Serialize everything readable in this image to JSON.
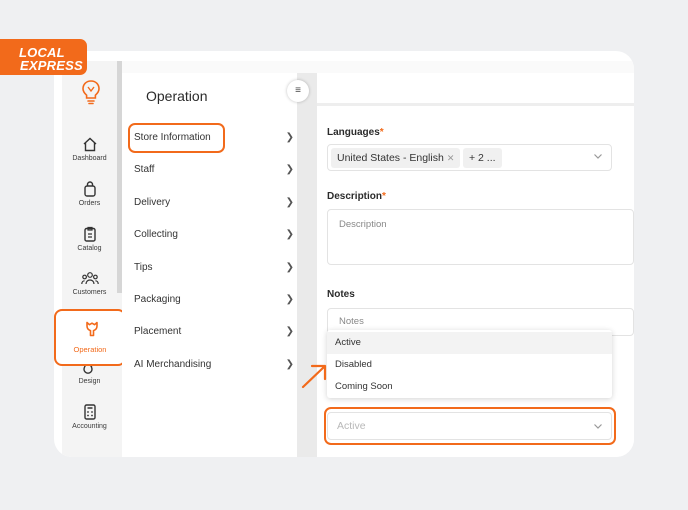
{
  "brand": {
    "logo_line1": "LOCAL",
    "logo_line2": "EXPRESS",
    "accent_color": "#f26a1b"
  },
  "iconbar": {
    "items": [
      {
        "label": "Dashboard",
        "icon": "home-icon"
      },
      {
        "label": "Orders",
        "icon": "bag-icon"
      },
      {
        "label": "Catalog",
        "icon": "clipboard-icon"
      },
      {
        "label": "Customers",
        "icon": "users-icon"
      },
      {
        "label": "Operation",
        "icon": "wrench-icon",
        "active": true
      },
      {
        "label": "Design",
        "icon": "drops-icon"
      },
      {
        "label": "Accounting",
        "icon": "calculator-icon"
      }
    ]
  },
  "menu": {
    "title": "Operation",
    "items": [
      {
        "label": "Store Information"
      },
      {
        "label": "Staff"
      },
      {
        "label": "Delivery"
      },
      {
        "label": "Collecting"
      },
      {
        "label": "Tips"
      },
      {
        "label": "Packaging"
      },
      {
        "label": "Placement"
      },
      {
        "label": "AI Merchandising"
      }
    ]
  },
  "form": {
    "languages_label": "Languages",
    "required_mark": "*",
    "language_tag": "United States - English",
    "language_more": "+ 2 ...",
    "description_label": "Description",
    "description_placeholder": "Description",
    "notes_label": "Notes",
    "notes_placeholder": "Notes",
    "status_options": [
      "Active",
      "Disabled",
      "Coming Soon"
    ],
    "status_selected": "Active"
  }
}
